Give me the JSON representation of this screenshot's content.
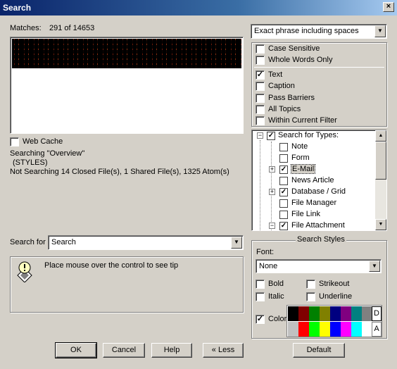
{
  "window": {
    "title": "Search",
    "close_glyph": "×"
  },
  "matches": {
    "label": "Matches:",
    "count": "291 of 14653"
  },
  "web_cache": {
    "label": "Web Cache",
    "checked": false
  },
  "status": {
    "line1": "Searching \"Overview\"",
    "line2": "(STYLES)",
    "line3": "Not Searching 14 Closed File(s), 1 Shared File(s), 1325 Atom(s)"
  },
  "search_for": {
    "label": "Search for",
    "value": "Search"
  },
  "tip": {
    "text": "Place mouse over the control to see tip",
    "icon": "tip-icon"
  },
  "buttons": {
    "ok": "OK",
    "cancel": "Cancel",
    "help": "Help",
    "less": "« Less",
    "default": "Default"
  },
  "match_mode": {
    "value": "Exact phrase including spaces"
  },
  "options": [
    {
      "label": "Case Sensitive",
      "checked": false
    },
    {
      "label": "Whole Words Only",
      "checked": false
    },
    {
      "label": "Text",
      "checked": true
    },
    {
      "label": "Caption",
      "checked": false
    },
    {
      "label": "Pass Barriers",
      "checked": false
    },
    {
      "label": "All Topics",
      "checked": false
    },
    {
      "label": "Within Current Filter",
      "checked": false
    }
  ],
  "types_tree": {
    "root": {
      "label": "Search for Types:",
      "checked": true,
      "expander": "−"
    },
    "items": [
      {
        "label": "Note",
        "checked": false,
        "expander": ""
      },
      {
        "label": "Form",
        "checked": false,
        "expander": ""
      },
      {
        "label": "E-Mail",
        "checked": true,
        "expander": "+"
      },
      {
        "label": "News Article",
        "checked": false,
        "expander": ""
      },
      {
        "label": "Database / Grid",
        "checked": true,
        "expander": "+"
      },
      {
        "label": "File Manager",
        "checked": false,
        "expander": ""
      },
      {
        "label": "File Link",
        "checked": false,
        "expander": ""
      },
      {
        "label": "File Attachment",
        "checked": true,
        "expander": "−"
      }
    ]
  },
  "search_styles": {
    "title": "Search Styles",
    "font_label": "Font:",
    "font_value": "None",
    "bold": "Bold",
    "italic": "Italic",
    "strikeout": "Strikeout",
    "underline": "Underline",
    "color": "Color",
    "color_checked": true,
    "d_label": "D",
    "a_label": "A",
    "palette_top": [
      "#000000",
      "#800000",
      "#008000",
      "#808000",
      "#000080",
      "#800080",
      "#008080",
      "#808080"
    ],
    "palette_bottom": [
      "#c0c0c0",
      "#ff0000",
      "#00ff00",
      "#ffff00",
      "#0000ff",
      "#ff00ff",
      "#00ffff",
      "#ffffff"
    ]
  },
  "check_glyph": "✓"
}
